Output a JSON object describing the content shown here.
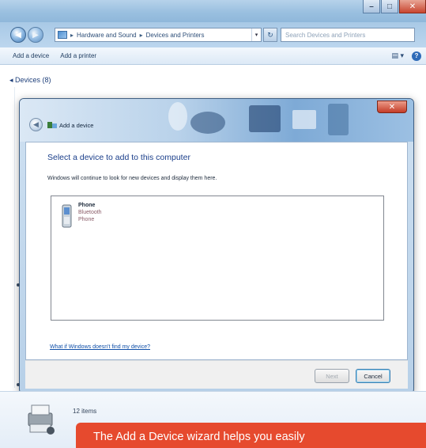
{
  "window": {
    "caption_buttons": {
      "minimize": "–",
      "maximize": "□",
      "close": "✕"
    }
  },
  "navbar": {
    "back_glyph": "◀",
    "forward_glyph": "▶",
    "address": {
      "segments": [
        "Hardware and Sound",
        "Devices and Printers"
      ],
      "separator": "▸",
      "dropdown": "▾"
    },
    "refresh_glyph": "↻",
    "search_placeholder": "Search Devices and Printers"
  },
  "toolbar": {
    "add_device": "Add a device",
    "add_printer": "Add a printer",
    "view_glyph": "▤ ▾",
    "help_glyph": "?"
  },
  "group": {
    "header": "◂ Devices (8)"
  },
  "dialog": {
    "back_glyph": "◀",
    "title": "Add a device",
    "close_glyph": "✕",
    "heading": "Select a device to add to this computer",
    "instruction": "Windows will continue to look for new devices and display them here.",
    "devices": [
      {
        "name": "Phone",
        "type": "Bluetooth",
        "category": "Phone",
        "icon": "phone-icon"
      }
    ],
    "help_link": "What if Windows doesn't find my device?",
    "next_label": "Next",
    "cancel_label": "Cancel"
  },
  "status": {
    "items": "12 items"
  },
  "caption": {
    "text": "The Add a Device wizard helps you easily"
  },
  "colors": {
    "caption_bg": "#e64a2e",
    "accent": "#1a3e8a"
  }
}
